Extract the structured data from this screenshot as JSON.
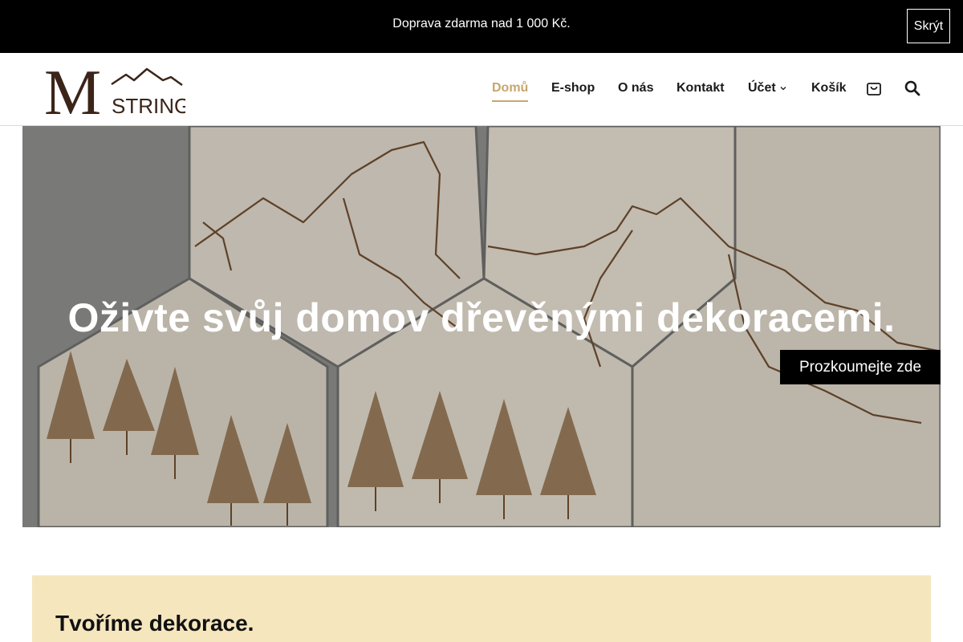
{
  "notice": {
    "text": "Doprava zdarma nad 1 000 Kč.",
    "hide_label": "Skrýt"
  },
  "brand": {
    "letter": "M",
    "name": "STRING",
    "color": "#3b2418"
  },
  "nav": {
    "items": [
      {
        "label": "Domů",
        "active": true
      },
      {
        "label": "E-shop"
      },
      {
        "label": "O nás"
      },
      {
        "label": "Kontakt"
      },
      {
        "label": "Účet",
        "has_dropdown": true
      },
      {
        "label": "Košík"
      }
    ],
    "cart_icon": "shopping-bag-icon",
    "search_icon": "search-icon",
    "accent": "#c7a66c"
  },
  "hero": {
    "title": "Oživte svůj domov dřevěnými dekoracemi.",
    "cta": "Prozkoumejte zde"
  },
  "intro": {
    "title": "Tvoříme dekorace.",
    "bg": "#f6e6be"
  }
}
